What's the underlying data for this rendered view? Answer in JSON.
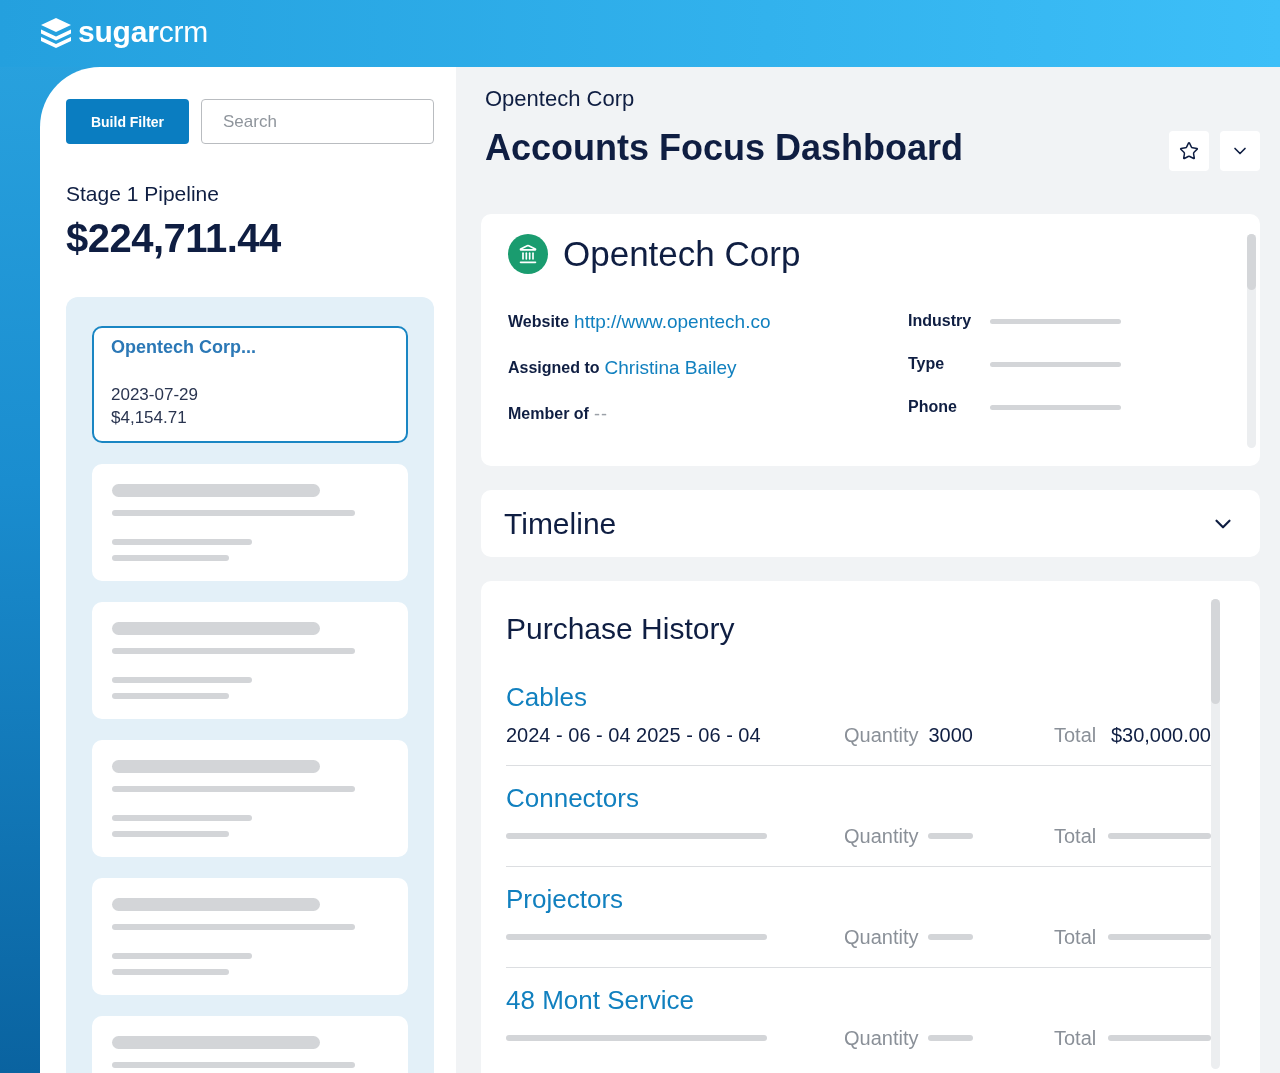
{
  "brand": {
    "logo": "**sugar**crm"
  },
  "sidebar": {
    "filter_button": "Build Filter",
    "search": {
      "placeholder": "Search"
    },
    "pipeline": {
      "title": "Stage 1 Pipeline",
      "amount": "$224,711.44"
    },
    "cards": [
      {
        "kind": "record",
        "selected": true,
        "title": "Opentech Corp...",
        "date": "2023-07-29",
        "amount": "$4,154.71"
      },
      {
        "kind": "skeleton",
        "selected": false
      },
      {
        "kind": "skeleton",
        "selected": false
      },
      {
        "kind": "skeleton",
        "selected": false
      },
      {
        "kind": "skeleton",
        "selected": false
      },
      {
        "kind": "skeleton",
        "selected": false
      }
    ]
  },
  "header": {
    "breadcrumb": "Opentech Corp",
    "title": "Accounts Focus Dashboard",
    "starred": false
  },
  "account": {
    "name": "Opentech Corp",
    "details_left": [
      {
        "kind": "link",
        "label": "Website",
        "value": "http://www.opentech.co"
      },
      {
        "kind": "link",
        "label": "Assigned to",
        "value": "Christina Bailey"
      },
      {
        "kind": "empty",
        "label": "Member of",
        "empty_mark": "--"
      }
    ],
    "details_right": [
      {
        "kind": "skeleton",
        "label": "Industry"
      },
      {
        "kind": "skeleton",
        "label": "Type"
      },
      {
        "kind": "skeleton",
        "label": "Phone"
      }
    ]
  },
  "timeline": {
    "title": "Timeline",
    "expanded": false
  },
  "purchase_history": {
    "title": "Purchase History",
    "items": [
      {
        "kind": "loaded",
        "name": "Cables",
        "dates": "2024 - 06 - 04 2025 - 06 - 04",
        "quantity_label": "Quantity",
        "quantity": "3000",
        "total_label": "Total",
        "total": "$30,000.00"
      },
      {
        "kind": "skeleton",
        "name": "Connectors",
        "quantity_label": "Quantity",
        "total_label": "Total"
      },
      {
        "kind": "skeleton",
        "name": "Projectors",
        "quantity_label": "Quantity",
        "total_label": "Total"
      },
      {
        "kind": "skeleton",
        "name": "48 Mont Service",
        "quantity_label": "Quantity",
        "total_label": "Total"
      }
    ]
  }
}
